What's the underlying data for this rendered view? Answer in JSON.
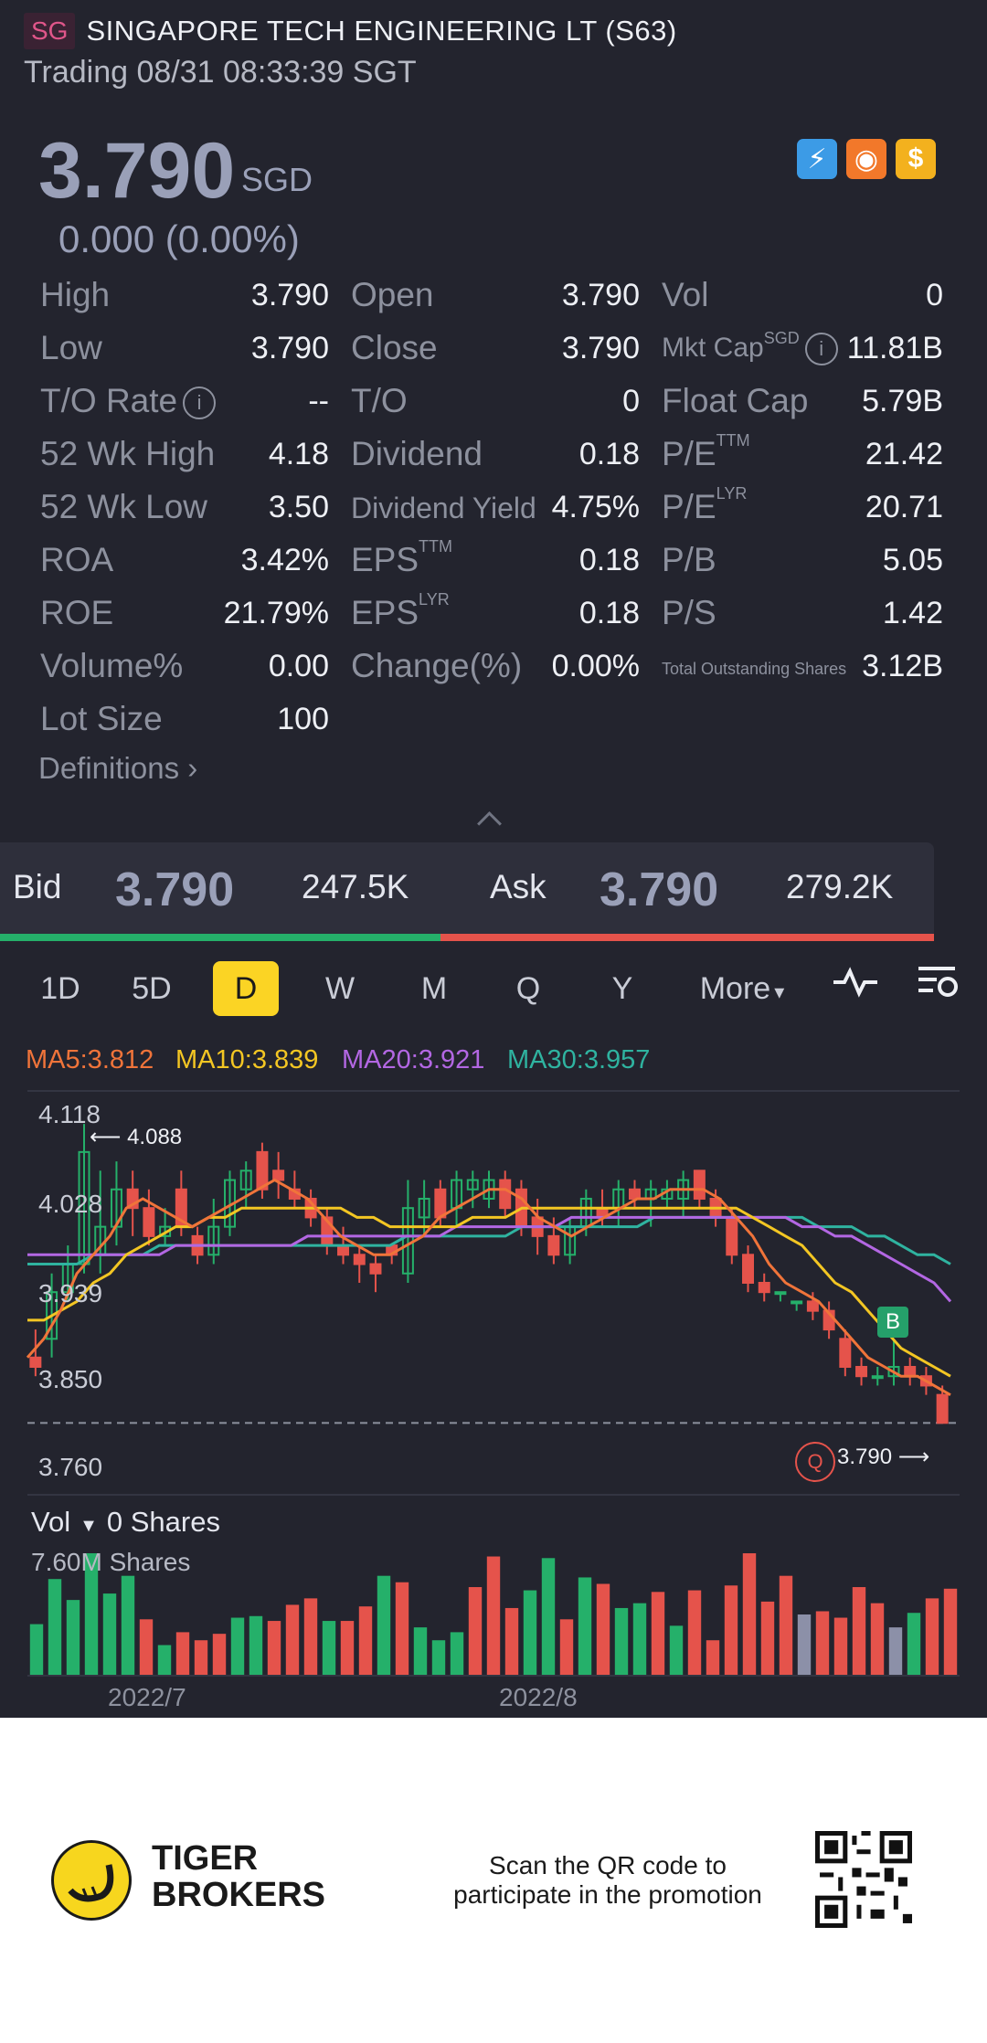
{
  "header": {
    "exchange_badge": "SG",
    "title": "SINGAPORE TECH ENGINEERING LT (S63)",
    "status": "Trading 08/31 08:33:39 SGT"
  },
  "quote": {
    "price": "3.790",
    "currency": "SGD",
    "change": "0.000 (0.00%)"
  },
  "badge_icons": [
    "lightning-icon",
    "basketball-icon",
    "dollar-icon"
  ],
  "stats": {
    "col1": [
      [
        "High",
        "3.790"
      ],
      [
        "Low",
        "3.790"
      ],
      [
        "T/O Rate",
        "--"
      ],
      [
        "52 Wk High",
        "4.18"
      ],
      [
        "52 Wk Low",
        "3.50"
      ],
      [
        "ROA",
        "3.42%"
      ],
      [
        "ROE",
        "21.79%"
      ],
      [
        "Volume%",
        "0.00"
      ],
      [
        "Lot Size",
        "100"
      ]
    ],
    "col2": [
      [
        "Open",
        "3.790"
      ],
      [
        "Close",
        "3.790"
      ],
      [
        "T/O",
        "0"
      ],
      [
        "Dividend",
        "0.18"
      ],
      [
        "Dividend Yield",
        "4.75%"
      ],
      [
        "EPS",
        "0.18"
      ],
      [
        "EPS",
        "0.18"
      ],
      [
        "Change(%)",
        "0.00%"
      ]
    ],
    "col3": [
      [
        "Vol",
        "0"
      ],
      [
        "Mkt Cap",
        "11.81B"
      ],
      [
        "Float Cap",
        "5.79B"
      ],
      [
        "P/E",
        "21.42"
      ],
      [
        "P/E",
        "20.71"
      ],
      [
        "P/B",
        "5.05"
      ],
      [
        "P/S",
        "1.42"
      ],
      [
        "Total Outstanding Shares",
        "3.12B"
      ]
    ],
    "sup": {
      "ttm": "TTM",
      "lyr": "LYR",
      "sgd": "SGD"
    }
  },
  "definitions": "Definitions",
  "bidask": {
    "bid_label": "Bid",
    "bid_price": "3.790",
    "bid_size": "247.5K",
    "ask_label": "Ask",
    "ask_price": "3.790",
    "ask_size": "279.2K"
  },
  "tabs": [
    "1D",
    "5D",
    "D",
    "W",
    "M",
    "Q",
    "Y"
  ],
  "active_tab": "D",
  "more_label": "More",
  "ma": {
    "ma5": "MA5:3.812",
    "ma10": "MA10:3.839",
    "ma20": "MA20:3.921",
    "ma30": "MA30:3.957"
  },
  "colors": {
    "up": "#25b06a",
    "down": "#e5534b",
    "ma5": "#f0743a",
    "ma10": "#f3c623",
    "ma20": "#b367e3",
    "ma30": "#2fb3a0",
    "neutral": "#8c90a8"
  },
  "chart_data": {
    "type": "candlestick",
    "y_ticks": [
      "4.118",
      "4.028",
      "3.939",
      "3.850",
      "3.760"
    ],
    "ylim": [
      3.76,
      4.118
    ],
    "high_marker": "4.088",
    "last_marker": "3.790",
    "b_marker": "B",
    "q_marker": "Q",
    "x_labels": [
      "2022/7",
      "2022/8"
    ],
    "candles": [
      {
        "o": 3.86,
        "h": 3.89,
        "l": 3.84,
        "c": 3.85
      },
      {
        "o": 3.88,
        "h": 3.95,
        "l": 3.86,
        "c": 3.93
      },
      {
        "o": 3.93,
        "h": 3.98,
        "l": 3.92,
        "c": 3.96
      },
      {
        "o": 3.96,
        "h": 4.11,
        "l": 3.95,
        "c": 4.08
      },
      {
        "o": 3.97,
        "h": 4.06,
        "l": 3.95,
        "c": 4.0
      },
      {
        "o": 4.0,
        "h": 4.07,
        "l": 3.98,
        "c": 4.04
      },
      {
        "o": 4.04,
        "h": 4.06,
        "l": 3.99,
        "c": 4.02
      },
      {
        "o": 4.02,
        "h": 4.04,
        "l": 3.98,
        "c": 3.99
      },
      {
        "o": 3.99,
        "h": 4.02,
        "l": 3.98,
        "c": 4.0
      },
      {
        "o": 4.04,
        "h": 4.06,
        "l": 3.99,
        "c": 4.0
      },
      {
        "o": 3.99,
        "h": 4.0,
        "l": 3.96,
        "c": 3.97
      },
      {
        "o": 3.97,
        "h": 4.03,
        "l": 3.96,
        "c": 4.0
      },
      {
        "o": 4.0,
        "h": 4.06,
        "l": 3.99,
        "c": 4.05
      },
      {
        "o": 4.04,
        "h": 4.07,
        "l": 4.02,
        "c": 4.06
      },
      {
        "o": 4.08,
        "h": 4.09,
        "l": 4.03,
        "c": 4.04
      },
      {
        "o": 4.06,
        "h": 4.08,
        "l": 4.03,
        "c": 4.05
      },
      {
        "o": 4.04,
        "h": 4.06,
        "l": 4.02,
        "c": 4.03
      },
      {
        "o": 4.03,
        "h": 4.04,
        "l": 4.0,
        "c": 4.01
      },
      {
        "o": 4.01,
        "h": 4.02,
        "l": 3.97,
        "c": 3.98
      },
      {
        "o": 3.98,
        "h": 4.0,
        "l": 3.96,
        "c": 3.97
      },
      {
        "o": 3.97,
        "h": 3.98,
        "l": 3.94,
        "c": 3.96
      },
      {
        "o": 3.96,
        "h": 3.97,
        "l": 3.93,
        "c": 3.95
      },
      {
        "o": 3.98,
        "h": 3.98,
        "l": 3.96,
        "c": 3.97
      },
      {
        "o": 3.95,
        "h": 4.05,
        "l": 3.94,
        "c": 4.02
      },
      {
        "o": 4.01,
        "h": 4.05,
        "l": 3.99,
        "c": 4.03
      },
      {
        "o": 4.04,
        "h": 4.05,
        "l": 4.0,
        "c": 4.01
      },
      {
        "o": 4.02,
        "h": 4.06,
        "l": 4.0,
        "c": 4.05
      },
      {
        "o": 4.04,
        "h": 4.06,
        "l": 4.02,
        "c": 4.05
      },
      {
        "o": 4.03,
        "h": 4.06,
        "l": 4.02,
        "c": 4.05
      },
      {
        "o": 4.05,
        "h": 4.06,
        "l": 4.01,
        "c": 4.02
      },
      {
        "o": 4.04,
        "h": 4.05,
        "l": 3.99,
        "c": 4.0
      },
      {
        "o": 4.01,
        "h": 4.03,
        "l": 3.97,
        "c": 3.99
      },
      {
        "o": 3.99,
        "h": 4.01,
        "l": 3.96,
        "c": 3.97
      },
      {
        "o": 3.97,
        "h": 4.01,
        "l": 3.96,
        "c": 4.0
      },
      {
        "o": 4.0,
        "h": 4.04,
        "l": 3.99,
        "c": 4.03
      },
      {
        "o": 4.02,
        "h": 4.04,
        "l": 4.0,
        "c": 4.01
      },
      {
        "o": 4.02,
        "h": 4.05,
        "l": 4.0,
        "c": 4.04
      },
      {
        "o": 4.04,
        "h": 4.05,
        "l": 4.02,
        "c": 4.03
      },
      {
        "o": 4.03,
        "h": 4.05,
        "l": 4.0,
        "c": 4.04
      },
      {
        "o": 4.03,
        "h": 4.05,
        "l": 4.02,
        "c": 4.04
      },
      {
        "o": 4.03,
        "h": 4.06,
        "l": 4.01,
        "c": 4.05
      },
      {
        "o": 4.06,
        "h": 4.06,
        "l": 4.02,
        "c": 4.03
      },
      {
        "o": 4.03,
        "h": 4.04,
        "l": 4.0,
        "c": 4.01
      },
      {
        "o": 4.01,
        "h": 4.02,
        "l": 3.96,
        "c": 3.97
      },
      {
        "o": 3.97,
        "h": 3.98,
        "l": 3.93,
        "c": 3.94
      },
      {
        "o": 3.94,
        "h": 3.95,
        "l": 3.92,
        "c": 3.93
      },
      {
        "o": 3.93,
        "h": 3.93,
        "l": 3.92,
        "c": 3.93
      },
      {
        "o": 3.92,
        "h": 3.92,
        "l": 3.91,
        "c": 3.92
      },
      {
        "o": 3.92,
        "h": 3.93,
        "l": 3.9,
        "c": 3.91
      },
      {
        "o": 3.91,
        "h": 3.92,
        "l": 3.88,
        "c": 3.89
      },
      {
        "o": 3.88,
        "h": 3.89,
        "l": 3.84,
        "c": 3.85
      },
      {
        "o": 3.85,
        "h": 3.86,
        "l": 3.83,
        "c": 3.84
      },
      {
        "o": 3.84,
        "h": 3.85,
        "l": 3.83,
        "c": 3.84
      },
      {
        "o": 3.84,
        "h": 3.88,
        "l": 3.83,
        "c": 3.85
      },
      {
        "o": 3.85,
        "h": 3.86,
        "l": 3.83,
        "c": 3.84
      },
      {
        "o": 3.84,
        "h": 3.85,
        "l": 3.82,
        "c": 3.83
      },
      {
        "o": 3.82,
        "h": 3.83,
        "l": 3.79,
        "c": 3.79
      }
    ],
    "ma5": [
      3.86,
      3.88,
      3.91,
      3.95,
      3.97,
      3.99,
      4.02,
      4.03,
      4.02,
      4.01,
      4.0,
      4.01,
      4.02,
      4.03,
      4.04,
      4.05,
      4.04,
      4.03,
      4.01,
      3.99,
      3.98,
      3.97,
      3.97,
      3.98,
      3.99,
      4.01,
      4.02,
      4.03,
      4.04,
      4.04,
      4.03,
      4.01,
      4.0,
      3.99,
      4.0,
      4.01,
      4.02,
      4.03,
      4.03,
      4.04,
      4.04,
      4.04,
      4.03,
      4.01,
      3.99,
      3.96,
      3.94,
      3.93,
      3.92,
      3.9,
      3.88,
      3.86,
      3.85,
      3.84,
      3.84,
      3.83,
      3.82
    ],
    "ma10": [
      3.9,
      3.9,
      3.91,
      3.92,
      3.94,
      3.95,
      3.97,
      3.98,
      3.99,
      4.0,
      4.0,
      4.01,
      4.01,
      4.02,
      4.02,
      4.02,
      4.02,
      4.02,
      4.02,
      4.02,
      4.01,
      4.01,
      4.0,
      4.0,
      4.0,
      4.0,
      4.0,
      4.01,
      4.01,
      4.01,
      4.02,
      4.02,
      4.02,
      4.02,
      4.02,
      4.02,
      4.02,
      4.02,
      4.02,
      4.02,
      4.02,
      4.02,
      4.02,
      4.02,
      4.01,
      4.0,
      3.99,
      3.98,
      3.96,
      3.94,
      3.93,
      3.91,
      3.89,
      3.87,
      3.86,
      3.85,
      3.84
    ],
    "ma20": [
      3.97,
      3.97,
      3.97,
      3.97,
      3.97,
      3.97,
      3.97,
      3.97,
      3.97,
      3.98,
      3.98,
      3.98,
      3.98,
      3.98,
      3.98,
      3.98,
      3.98,
      3.99,
      3.99,
      3.99,
      3.99,
      3.99,
      3.99,
      3.99,
      3.99,
      3.99,
      4.0,
      4.0,
      4.0,
      4.0,
      4.0,
      4.0,
      4.0,
      4.01,
      4.01,
      4.01,
      4.01,
      4.01,
      4.01,
      4.01,
      4.01,
      4.01,
      4.01,
      4.01,
      4.01,
      4.01,
      4.01,
      4.0,
      4.0,
      3.99,
      3.99,
      3.98,
      3.97,
      3.96,
      3.95,
      3.94,
      3.92
    ],
    "ma30": [
      3.96,
      3.96,
      3.96,
      3.96,
      3.97,
      3.97,
      3.97,
      3.97,
      3.98,
      3.98,
      3.98,
      3.98,
      3.98,
      3.98,
      3.98,
      3.98,
      3.98,
      3.98,
      3.98,
      3.98,
      3.98,
      3.98,
      3.98,
      3.99,
      3.99,
      3.99,
      3.99,
      3.99,
      3.99,
      3.99,
      4.0,
      4.0,
      4.0,
      4.0,
      4.0,
      4.0,
      4.0,
      4.0,
      4.01,
      4.01,
      4.01,
      4.01,
      4.01,
      4.01,
      4.01,
      4.01,
      4.01,
      4.01,
      4.0,
      4.0,
      4.0,
      3.99,
      3.99,
      3.98,
      3.97,
      3.97,
      3.96
    ],
    "volume_label": "Vol",
    "volume_value": "0 Shares",
    "volume_max": "7.60M Shares",
    "volume": [
      {
        "v": 3.2,
        "d": "up"
      },
      {
        "v": 6.0,
        "d": "up"
      },
      {
        "v": 4.7,
        "d": "up"
      },
      {
        "v": 7.6,
        "d": "up"
      },
      {
        "v": 5.1,
        "d": "up"
      },
      {
        "v": 6.2,
        "d": "up"
      },
      {
        "v": 3.5,
        "d": "down"
      },
      {
        "v": 1.9,
        "d": "up"
      },
      {
        "v": 2.7,
        "d": "down"
      },
      {
        "v": 2.2,
        "d": "down"
      },
      {
        "v": 2.6,
        "d": "down"
      },
      {
        "v": 3.6,
        "d": "up"
      },
      {
        "v": 3.7,
        "d": "up"
      },
      {
        "v": 3.4,
        "d": "down"
      },
      {
        "v": 4.4,
        "d": "down"
      },
      {
        "v": 4.8,
        "d": "down"
      },
      {
        "v": 3.4,
        "d": "up"
      },
      {
        "v": 3.4,
        "d": "down"
      },
      {
        "v": 4.3,
        "d": "down"
      },
      {
        "v": 6.2,
        "d": "up"
      },
      {
        "v": 5.8,
        "d": "down"
      },
      {
        "v": 3.0,
        "d": "up"
      },
      {
        "v": 2.2,
        "d": "up"
      },
      {
        "v": 2.7,
        "d": "up"
      },
      {
        "v": 5.5,
        "d": "down"
      },
      {
        "v": 7.4,
        "d": "down"
      },
      {
        "v": 4.2,
        "d": "down"
      },
      {
        "v": 5.3,
        "d": "up"
      },
      {
        "v": 7.3,
        "d": "up"
      },
      {
        "v": 3.5,
        "d": "down"
      },
      {
        "v": 6.1,
        "d": "up"
      },
      {
        "v": 5.7,
        "d": "down"
      },
      {
        "v": 4.2,
        "d": "up"
      },
      {
        "v": 4.5,
        "d": "up"
      },
      {
        "v": 5.2,
        "d": "down"
      },
      {
        "v": 3.1,
        "d": "up"
      },
      {
        "v": 5.3,
        "d": "down"
      },
      {
        "v": 2.2,
        "d": "down"
      },
      {
        "v": 5.6,
        "d": "down"
      },
      {
        "v": 7.6,
        "d": "down"
      },
      {
        "v": 4.6,
        "d": "down"
      },
      {
        "v": 6.2,
        "d": "down"
      },
      {
        "v": 3.8,
        "d": "flat"
      },
      {
        "v": 4.0,
        "d": "down"
      },
      {
        "v": 3.6,
        "d": "down"
      },
      {
        "v": 5.5,
        "d": "down"
      },
      {
        "v": 4.5,
        "d": "down"
      },
      {
        "v": 3.0,
        "d": "flat"
      },
      {
        "v": 3.9,
        "d": "up"
      },
      {
        "v": 4.8,
        "d": "down"
      },
      {
        "v": 5.4,
        "d": "down"
      }
    ]
  },
  "footer": {
    "brand_line1": "TIGER",
    "brand_line2": "BROKERS",
    "promo_line1": "Scan the QR code to",
    "promo_line2": "participate in the promotion"
  }
}
